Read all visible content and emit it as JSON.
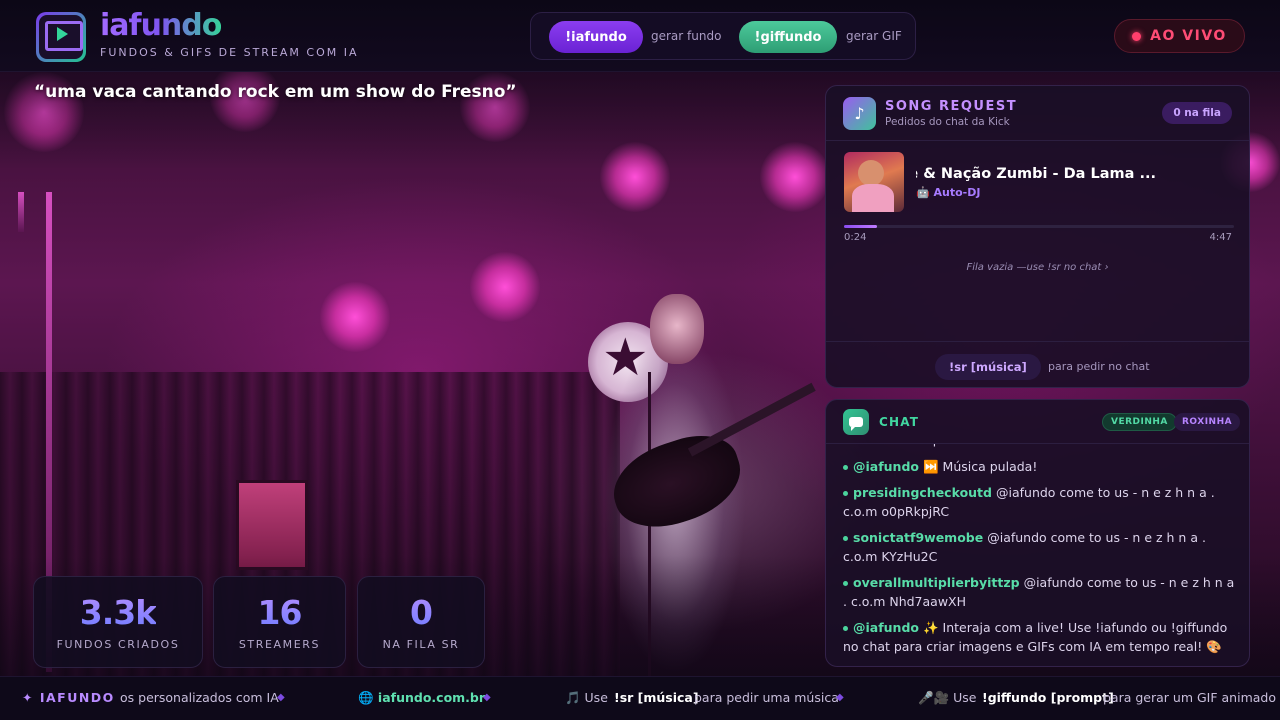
{
  "header": {
    "brand_title": "iafundo",
    "brand_subtitle": "FUNDOS & GIFS DE STREAM COM IA",
    "commands": [
      {
        "label": "!iafundo",
        "hint": "gerar fundo"
      },
      {
        "label": "!giffundo",
        "hint": "gerar GIF"
      }
    ],
    "live_label": "AO VIVO"
  },
  "prompt_text": "“uma vaca cantando rock em um show do Fresno”",
  "stats": [
    {
      "value": "3.3k",
      "label": "FUNDOS CRIADOS"
    },
    {
      "value": "16",
      "label": "STREAMERS"
    },
    {
      "value": "0",
      "label": "NA FILA SR"
    }
  ],
  "song_request": {
    "title": "SONG REQUEST",
    "subtitle": "Pedidos do chat da Kick",
    "queue_badge": "0 na fila",
    "now_playing": {
      "title": "Chico Science & Nação Zumbi - Da Lama ...",
      "source": "🤖 Auto-DJ",
      "current_time": "0:24",
      "total_time": "4:47",
      "progress": 0.085
    },
    "empty_text": "Fila vazia —use !sr no chat ›",
    "command_label": "!sr [música]",
    "command_hint": "para pedir no chat"
  },
  "chat": {
    "title": "CHAT",
    "tags": [
      "VERDINHA",
      "ROXINHA"
    ],
    "messages": [
      {
        "user": "iafundo",
        "text": "!skip"
      },
      {
        "user": "@iafundo",
        "text": "⏭️ Música pulada!"
      },
      {
        "user": "presidingcheckoutd",
        "text": "@iafundo come to us - n e z h n a . c.o.m o0pRkpjRC"
      },
      {
        "user": "sonictatf9wemobe",
        "text": "@iafundo come to us - n e z h n a . c.o.m KYzHu2C"
      },
      {
        "user": "overallmultiplierbyittzp",
        "text": "@iafundo come to us - n e z h n a . c.o.m Nhd7aawXH"
      },
      {
        "user": "@iafundo",
        "text": "✨ Interaja com a live! Use !iafundo ou !giffundo no chat para criar imagens e GIFs com IA em tempo real! 🎨"
      }
    ]
  },
  "ticker": {
    "brand": "✦ IAFUNDO",
    "item1": "os personalizados com IA",
    "url": "🌐  iafundo.com.br",
    "item2_prefix": "🎵 Use",
    "item2_cmd": "!sr [música]",
    "item2_suffix": "para pedir uma música",
    "item3_prefix": "🎤🎥 Use",
    "item3_cmd": "!giffundo [prompt]",
    "item3_suffix": "para gerar um GIF animado ao"
  },
  "colors": {
    "accent_purple": "#8b3df0",
    "accent_green": "#4cc99b",
    "live_red": "#ff3f6c"
  },
  "icons": {
    "logo": "monitor-play-icon",
    "song_request": "music-note-icon",
    "chat": "chat-bubble-icon",
    "live": "live-dot-icon"
  }
}
